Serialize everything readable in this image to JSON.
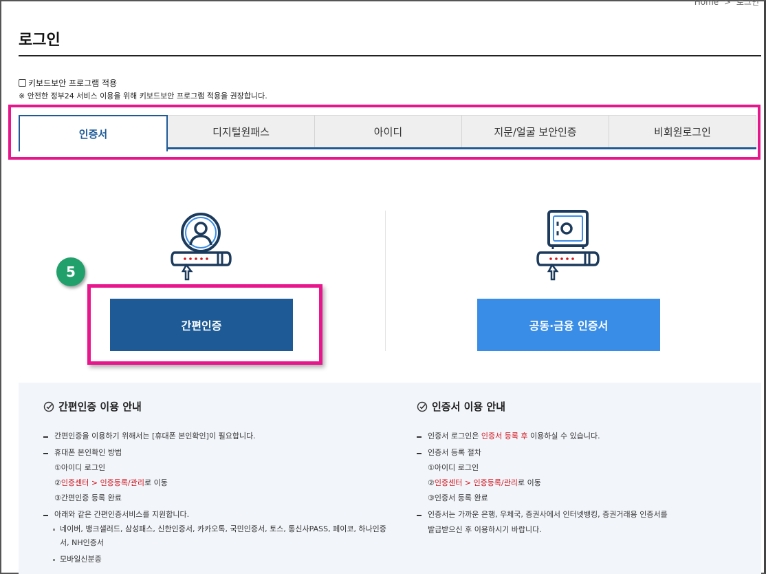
{
  "breadcrumb": {
    "home": "Home",
    "sep": ">",
    "current": "로그인"
  },
  "page": {
    "title": "로그인"
  },
  "keyboard_security": {
    "label": "키보드보안 프로그램 적용",
    "checked": false,
    "note": "※ 안전한 정부24 서비스 이용을 위해 키보드보안 프로그램 적용을 권장합니다."
  },
  "tabs": [
    {
      "label": "인증서",
      "active": true
    },
    {
      "label": "디지털원패스",
      "active": false
    },
    {
      "label": "아이디",
      "active": false
    },
    {
      "label": "지문/얼굴 보안인증",
      "active": false
    },
    {
      "label": "비회원로그인",
      "active": false
    }
  ],
  "step_badge": "5",
  "buttons": {
    "simple_auth": "간편인증",
    "joint_cert": "공동·금융 인증서"
  },
  "guide_simple": {
    "title": "간편인증 이용 안내",
    "item1": "간편인증을 이용하기 위해서는 [휴대폰 본인확인]이 필요합니다.",
    "item2": "휴대폰 본인확인 방법",
    "step1": "①아이디 로그인",
    "step2_prefix": "②",
    "step2_red": "인증센터 > 인증등록/관리",
    "step2_suffix": "로 이동",
    "step3": "③간편인증 등록 완료",
    "item3": "아래와 같은 간편인증서비스를 지원합니다.",
    "services": "네이버, 뱅크샐러드, 삼성패스, 신한인증서, 카카오톡, 국민인증서, 토스, 통신사PASS, 페이코, 하나인증서, NH인증서",
    "mobile_id": "모바일신분증"
  },
  "guide_cert": {
    "title": "인증서 이용 안내",
    "item1_prefix": "인증서 로그인은 ",
    "item1_red": "인증서 등록 후",
    "item1_suffix": " 이용하실 수 있습니다.",
    "item2": "인증서 등록 절차",
    "step1": "①아이디 로그인",
    "step2_prefix": "②",
    "step2_red": "인증센터 > 인증등록/관리",
    "step2_suffix": "로 이동",
    "step3": "③인증서 등록 완료",
    "item3_line1": "인증서는 가까운 은행, 우체국, 증권사에서 인터넷뱅킹, 증권거래용 인증서를",
    "item3_line2": "발급받으신 후 이용하시기 바랍니다."
  },
  "colors": {
    "primary": "#1d5a96",
    "secondary": "#3a8de6",
    "highlight": "#e8168c",
    "badge": "#22a06b",
    "emphasis": "#d1161e"
  },
  "icons": [
    "person-key-icon",
    "safe-key-icon",
    "check-circle-icon"
  ]
}
